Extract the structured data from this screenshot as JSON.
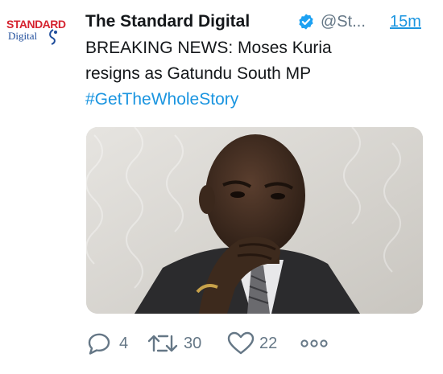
{
  "account": {
    "display_name": "The Standard Digital",
    "handle": "@St...",
    "timestamp": "15m",
    "verified": true,
    "logo_text_top": "STANDARD",
    "logo_text_bottom": "Digital"
  },
  "tweet": {
    "line1": "BREAKING NEWS: Moses Kuria",
    "line2": "resigns as Gatundu South MP",
    "hashtag": "#GetTheWholeStory"
  },
  "actions": {
    "reply_count": "4",
    "retweet_count": "30",
    "like_count": "22"
  },
  "icons": {
    "reply": "reply-icon",
    "retweet": "retweet-icon",
    "like": "heart-icon",
    "more": "more-dots-icon",
    "verified": "verified-badge-icon"
  },
  "colors": {
    "link": "#1b95e0",
    "secondary_text": "#657786",
    "primary_text": "#14171a",
    "logo_red": "#d5232f",
    "logo_blue": "#1f4d9b"
  }
}
